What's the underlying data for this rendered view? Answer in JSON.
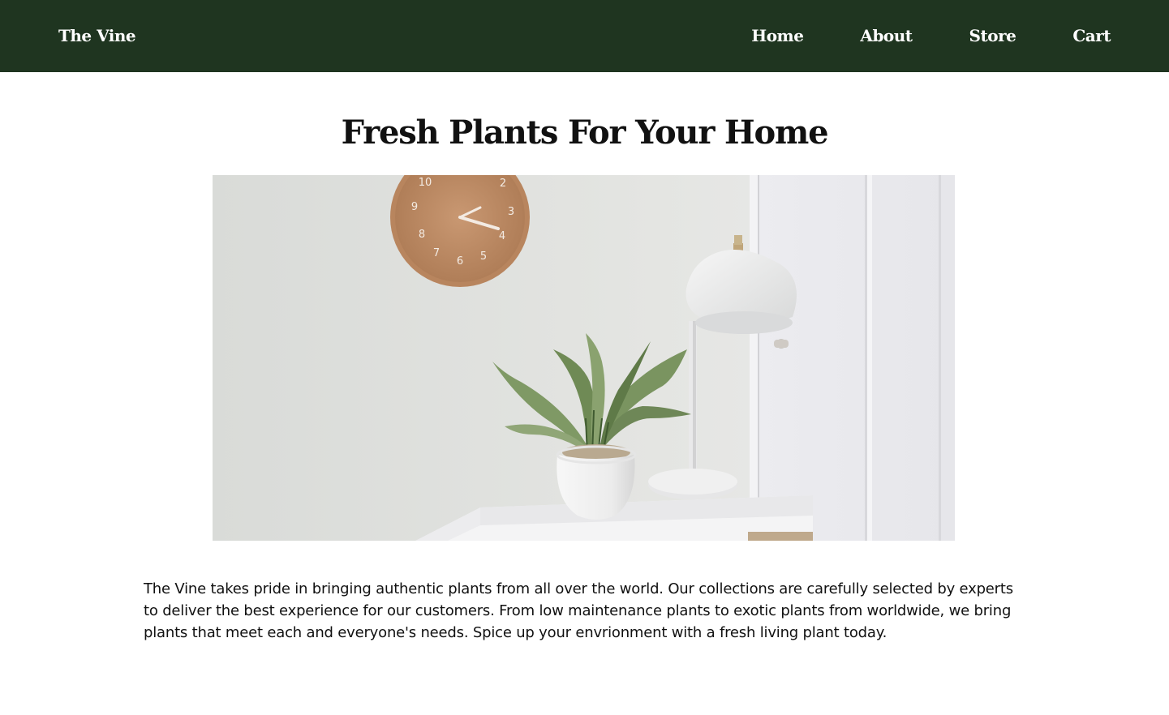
{
  "nav": {
    "brand": "The Vine",
    "links": [
      "Home",
      "About",
      "Store",
      "Cart"
    ]
  },
  "main": {
    "title": "Fresh Plants For Your Home",
    "hero_image_alt": "Potted plant on a white table beside a lamp and wall clock",
    "description": "The Vine takes pride in bringing authentic plants from all over the world. Our collections are carefully selected by experts to deliver the best experience for our customers. From low maintenance plants to exotic plants from worldwide, we bring plants that meet each and everyone's needs. Spice up your envrionment with a fresh living plant today."
  },
  "colors": {
    "navbar": "#1f3520",
    "nav_text": "#ffffff",
    "text": "#111111"
  }
}
